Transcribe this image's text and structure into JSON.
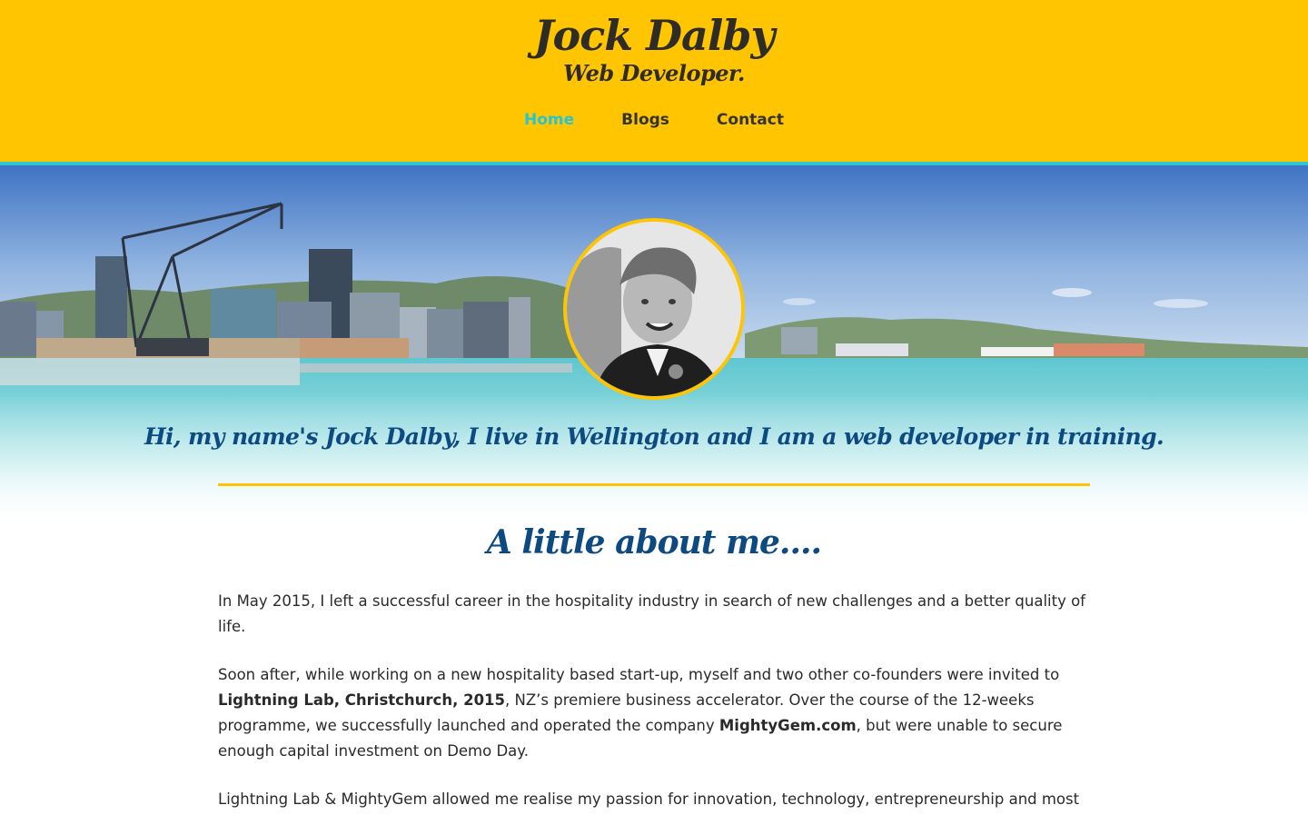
{
  "header": {
    "name": "Jock Dalby",
    "role": "Web Developer.",
    "nav": [
      {
        "label": "Home",
        "active": true
      },
      {
        "label": "Blogs",
        "active": false
      },
      {
        "label": "Contact",
        "active": false
      }
    ]
  },
  "hero": {
    "avatar_alt_icon": "profile-photo",
    "tagline": "Hi, my name's Jock Dalby, I live in Wellington and I am a web developer in training."
  },
  "about": {
    "title": "A little about me....",
    "p1": "In May 2015, I left a successful career in the hospitality industry in search of new challenges and a better quality of life.",
    "p2_a": "Soon after, while working on a new hospitality based start-up, myself and two other co-founders were invited to ",
    "p2_b": "Lightning Lab, Christchurch, 2015",
    "p2_c": ", NZ’s premiere business accelerator. Over the course of the 12-weeks programme, we successfully launched and operated the company ",
    "p2_d": "MightyGem.com",
    "p2_e": ", but were unable to secure enough capital investment on Demo Day.",
    "p3": "Lightning Lab & MightyGem allowed me realise my passion for innovation, technology, entrepreneurship and most"
  },
  "colors": {
    "header_bg": "#ffc500",
    "accent": "#25c6d4",
    "heading": "#0d4a82",
    "text": "#2a2a2a"
  }
}
